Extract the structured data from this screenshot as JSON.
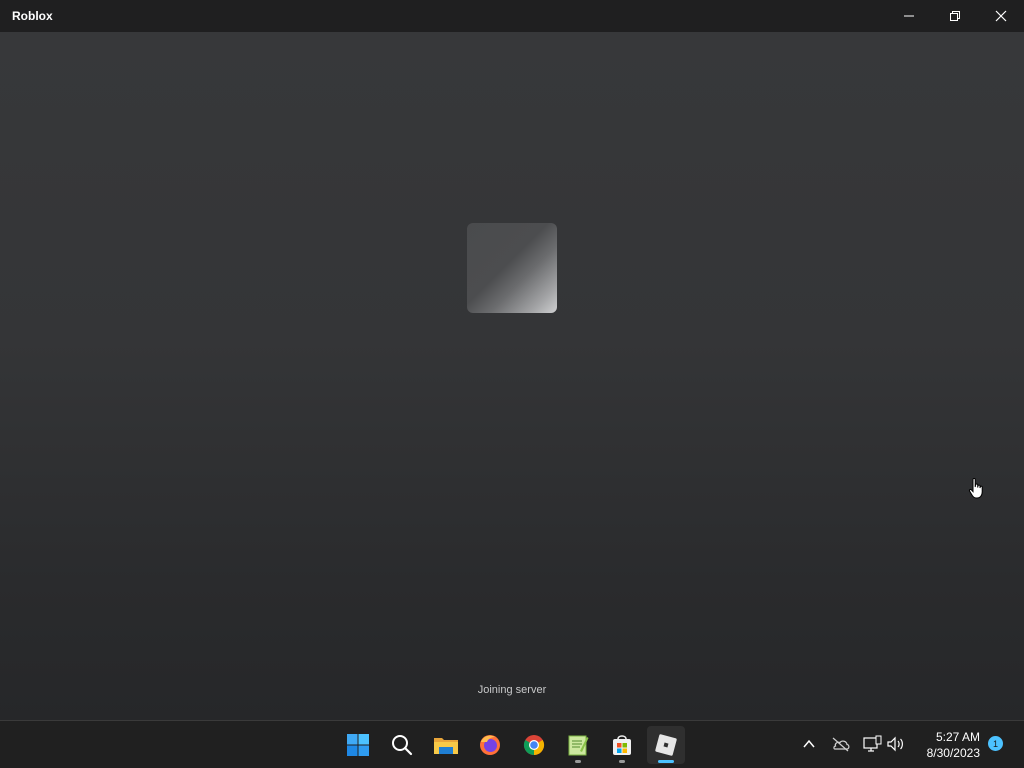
{
  "window": {
    "title": "Roblox",
    "controls": [
      "minimize",
      "restore",
      "close"
    ]
  },
  "game": {
    "status_text": "Joining server",
    "logo_icon": "roblox-logo-tile"
  },
  "taskbar": {
    "pinned": [
      {
        "name": "start",
        "icon": "windows-start-icon"
      },
      {
        "name": "search",
        "icon": "search-icon"
      },
      {
        "name": "file-explorer",
        "icon": "folder-icon"
      },
      {
        "name": "firefox",
        "icon": "firefox-icon"
      },
      {
        "name": "chrome",
        "icon": "chrome-icon"
      },
      {
        "name": "notepad-plus-plus",
        "icon": "notepad-icon",
        "running": true
      },
      {
        "name": "microsoft-store",
        "icon": "store-icon",
        "running": true
      },
      {
        "name": "roblox",
        "icon": "roblox-icon",
        "running": true,
        "active": true
      }
    ],
    "tray": {
      "icons": [
        "chevron-up-icon",
        "onedrive-offline-icon",
        "network-icon",
        "volume-icon"
      ],
      "time": "5:27 AM",
      "date": "8/30/2023",
      "notification_count": "1"
    }
  },
  "colors": {
    "accent": "#4cc2ff",
    "titlebar": "#1f1f20",
    "taskbar": "#202020"
  }
}
